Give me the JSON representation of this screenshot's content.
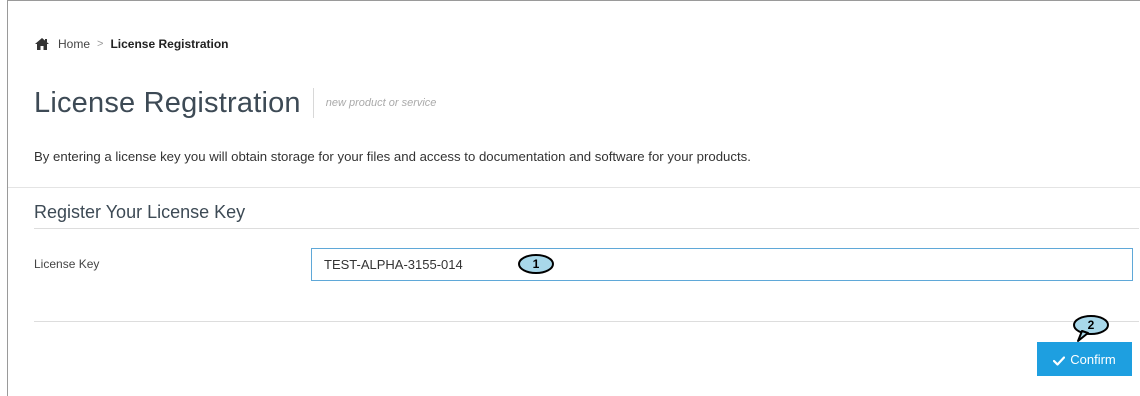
{
  "breadcrumb": {
    "home_icon": "home-icon",
    "home_label": "Home",
    "separator": ">",
    "current_label": "License Registration"
  },
  "page": {
    "title": "License Registration",
    "subtitle": "new product or service",
    "intro": "By entering a license key you will obtain storage for your files and access to documentation and software for your products."
  },
  "form": {
    "section_title": "Register Your License Key",
    "license_key_label": "License Key",
    "license_key_value": "TEST-ALPHA-3155-014"
  },
  "actions": {
    "confirm_icon": "check-icon",
    "confirm_label": "Confirm"
  },
  "callouts": {
    "step1": "1",
    "step2": "2",
    "color": "#a8d8ea"
  },
  "colors": {
    "accent": "#1e9fe0",
    "input_border": "#5fa8d8",
    "title": "#3d4a55"
  }
}
